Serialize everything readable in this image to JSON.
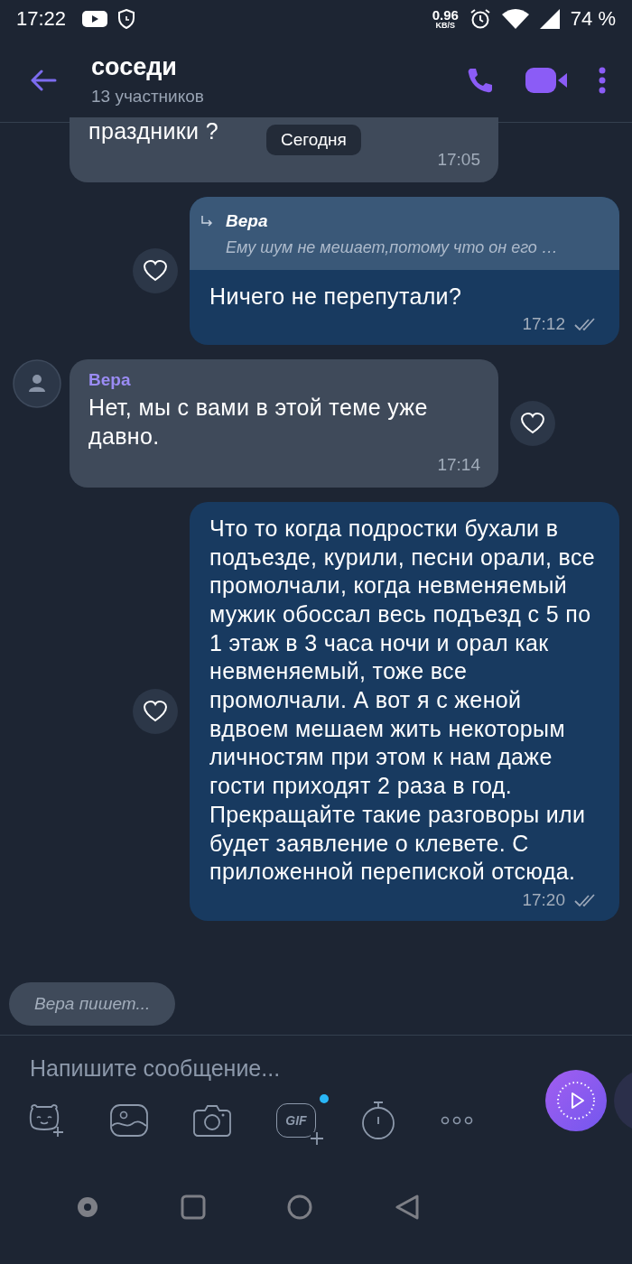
{
  "status_bar": {
    "time": "17:22",
    "speed": "0.96",
    "speed_unit": "KB/S",
    "battery": "74 %"
  },
  "header": {
    "title": "соседи",
    "subtitle": "13 участников"
  },
  "date_pill": "Сегодня",
  "messages": [
    {
      "kind": "incoming",
      "text": "праздники ?",
      "time": "17:05"
    },
    {
      "kind": "outgoing",
      "quote_author": "Вера",
      "quote_text": "Ему шум не мешает,потому что он его …",
      "text": "Ничего не перепутали?",
      "time": "17:12"
    },
    {
      "kind": "incoming",
      "author": "Вера",
      "text": "Нет, мы с вами в этой теме уже давно.",
      "time": "17:14"
    },
    {
      "kind": "outgoing",
      "text": "Что то когда подростки бухали в подъезде, курили, песни орали, все промолчали, когда невменяемый мужик обоссал весь подъезд с 5 по 1 этаж в 3 часа ночи и орал как невменяемый, тоже все промолчали. А вот я с женой вдвоем мешаем жить некоторым личностям при этом к нам даже гости приходят 2 раза в год. Прекращайте такие разговоры или будет заявление о клевете. С приложенной перепиской отсюда.",
      "time": "17:20"
    }
  ],
  "typing": "Вера пишет...",
  "composer": {
    "placeholder": "Напишите сообщение..."
  },
  "toolbar": [
    {
      "kind": "sticker"
    },
    {
      "kind": "gallery"
    },
    {
      "kind": "camera"
    },
    {
      "kind": "gif",
      "text": "GIF",
      "badge": true
    },
    {
      "kind": "timer"
    },
    {
      "kind": "more"
    }
  ]
}
